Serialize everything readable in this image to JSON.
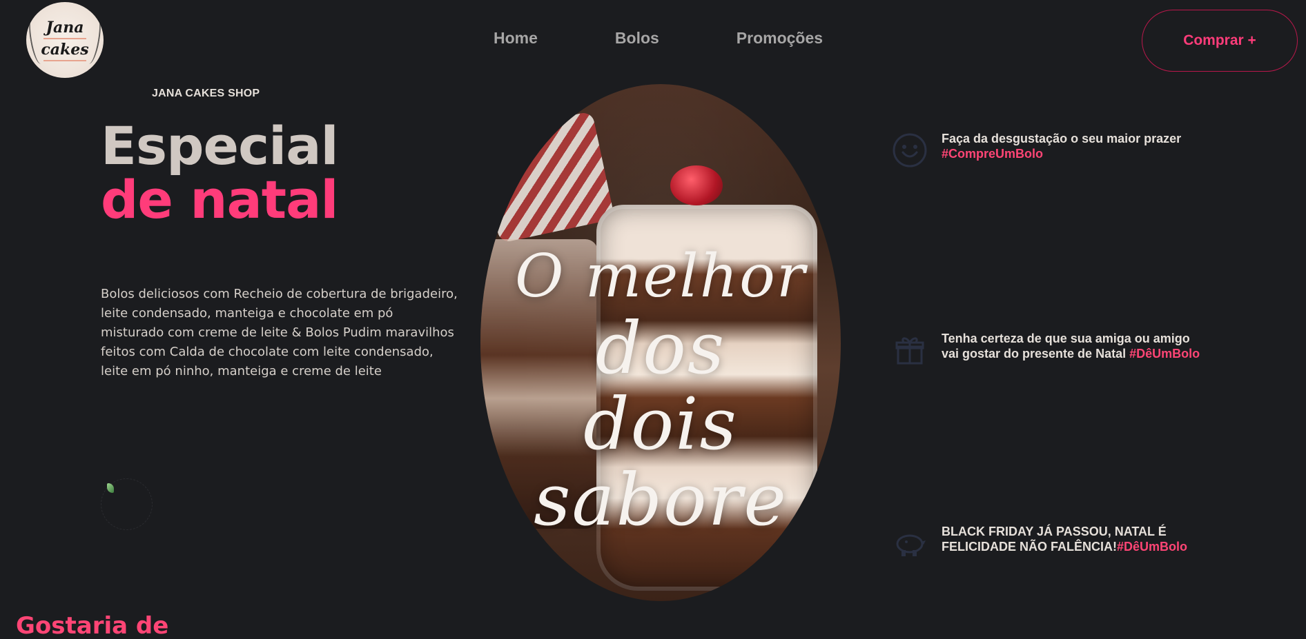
{
  "header": {
    "logo": {
      "line1": "Jana",
      "line2": "cakes"
    },
    "nav": [
      {
        "label": "Home"
      },
      {
        "label": "Bolos"
      },
      {
        "label": "Promoções"
      }
    ],
    "buy_button": "Comprar +"
  },
  "hero": {
    "kicker": "JANA CAKES SHOP",
    "title_line1": "Especial",
    "title_line2": "de natal",
    "description": "Bolos deliciosos com Recheio de cobertura de brigadeiro, leite condensado, manteiga e chocolate em pó misturado com creme de leite & Bolos Pudim maravilhos feitos com Calda de chocolate com leite condensado, leite em pó ninho, manteiga e creme de leite",
    "image_script": [
      "O melhor",
      "dos",
      "dois",
      "sabore"
    ]
  },
  "features": [
    {
      "icon": "smile-icon",
      "text": "Faça da desgustação o seu maior prazer",
      "tag": "#CompreUmBolo"
    },
    {
      "icon": "gift-icon",
      "text_line1": "Tenha certeza de que sua amiga ou amigo",
      "text_line2": "vai gostar do presente de Natal",
      "tag": "#DêUmBolo"
    },
    {
      "icon": "piggy-bank-icon",
      "text_line1": "BLACK FRIDAY JÁ PASSOU, NATAL É",
      "text_line2": "FELICIDADE NÃO FALÊNCIA!",
      "tag": "#DêUmBolo"
    }
  ],
  "section": {
    "heading_partial": "Gostaria de"
  },
  "colors": {
    "background": "#1b1c1f",
    "accent": "#ff3c7a",
    "accent_dark": "#b9184b",
    "nav_text": "#a7a6a6",
    "icon": "#2a3042"
  }
}
